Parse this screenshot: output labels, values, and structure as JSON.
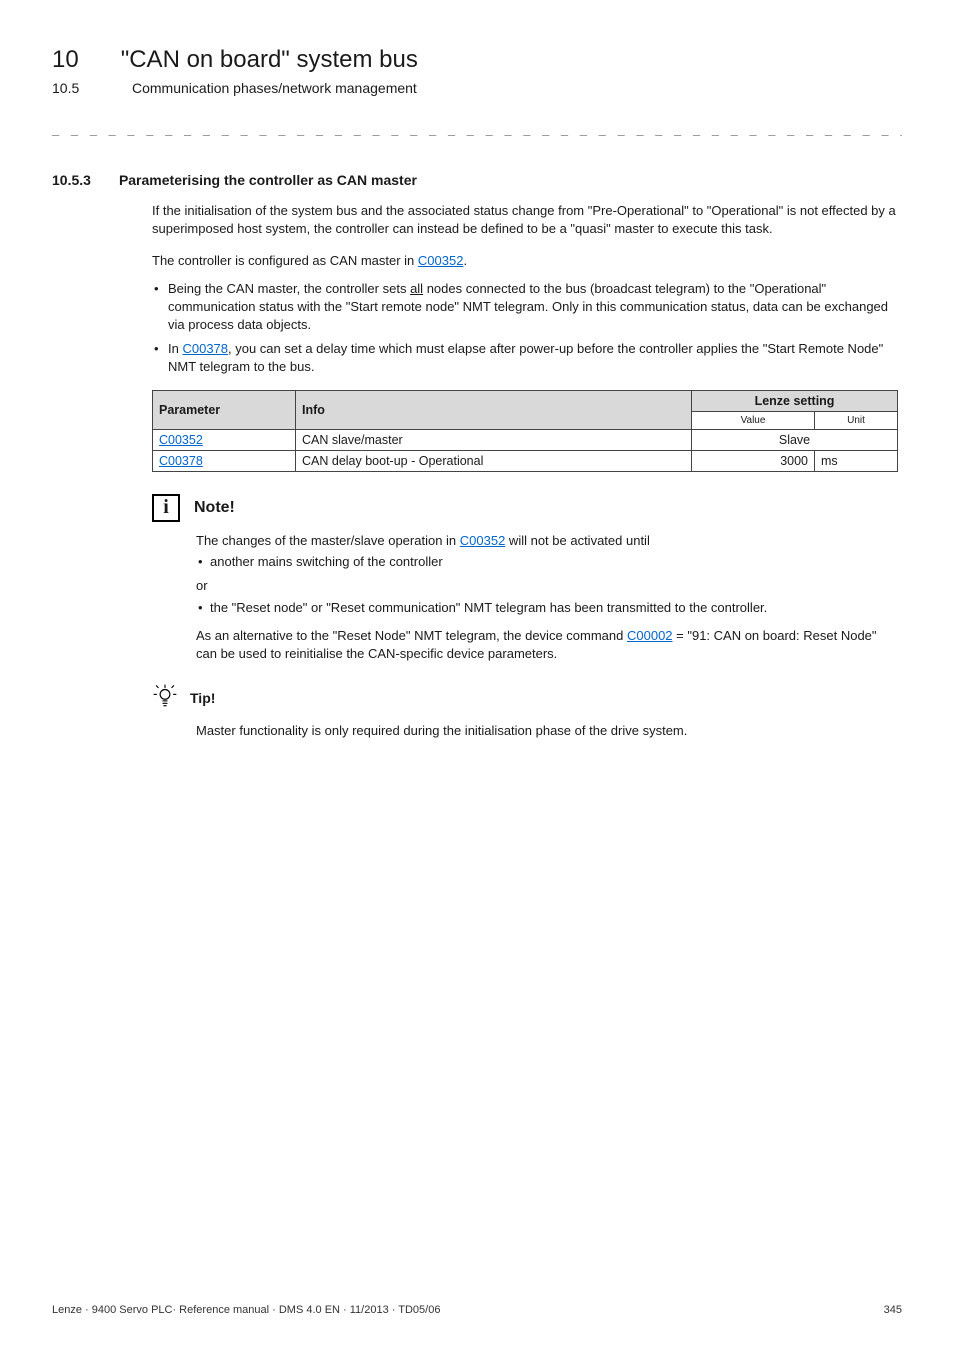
{
  "header": {
    "chapter_number": "10",
    "chapter_title": "\"CAN on board\" system bus",
    "sub_number": "10.5",
    "sub_title": "Communication phases/network management"
  },
  "rule": "_ _ _ _ _ _ _ _ _ _ _ _ _ _ _ _ _ _ _ _ _ _ _ _ _ _ _ _ _ _ _ _ _ _ _ _ _ _ _ _ _ _ _ _ _ _ _ _ _ _ _ _ _ _ _ _ _ _ _ _ _ _ _ _",
  "section": {
    "number": "10.5.3",
    "title": "Parameterising the controller as CAN master"
  },
  "paras": {
    "p1": "If the initialisation of the system bus and the associated status change from \"Pre-Operational\" to \"Operational\" is not effected by a superimposed host system, the controller can instead be defined to be a \"quasi\" master to execute this task.",
    "p2_pre": "The controller is configured as CAN master in ",
    "p2_link": "C00352",
    "p2_post": "."
  },
  "bullets": {
    "b1_pre": "Being the CAN master, the controller sets ",
    "b1_underlined": "all",
    "b1_post": " nodes connected to the bus (broadcast telegram) to the \"Operational\" communication status with the \"Start remote node\" NMT telegram. Only in this communication status, data can be exchanged via process data objects.",
    "b2_pre": "In ",
    "b2_link": "C00378",
    "b2_post": ", you can set a delay time which must elapse after power-up before the controller applies the \"Start Remote Node\" NMT telegram to the bus."
  },
  "table": {
    "headers": {
      "parameter": "Parameter",
      "info": "Info",
      "setting": "Lenze setting"
    },
    "subheaders": {
      "value": "Value",
      "unit": "Unit"
    },
    "rows": [
      {
        "param_link": "C00352",
        "info": "CAN slave/master",
        "value": "Slave",
        "unit": ""
      },
      {
        "param_link": "C00378",
        "info": "CAN delay boot-up - Operational",
        "value": "3000",
        "unit": "ms"
      }
    ]
  },
  "note": {
    "title": "Note!",
    "line1_pre": "The changes of the master/slave operation in ",
    "line1_link": "C00352",
    "line1_post": " will not be activated until",
    "bullet1": "another mains switching of the controller",
    "or": "or",
    "bullet2": "the \"Reset node\" or \"Reset communication\" NMT telegram has been transmitted to the controller.",
    "line2_pre": "As an alternative to the \"Reset Node\" NMT telegram, the device command ",
    "line2_link": "C00002",
    "line2_post": " = \"91: CAN on board: Reset Node\" can be used to reinitialise the CAN-specific device parameters."
  },
  "tip": {
    "title": "Tip!",
    "body": "Master functionality is only required during the initialisation phase of the drive system."
  },
  "footer": {
    "left": "Lenze · 9400 Servo PLC· Reference manual · DMS 4.0 EN · 11/2013 · TD05/06",
    "right": "345"
  }
}
